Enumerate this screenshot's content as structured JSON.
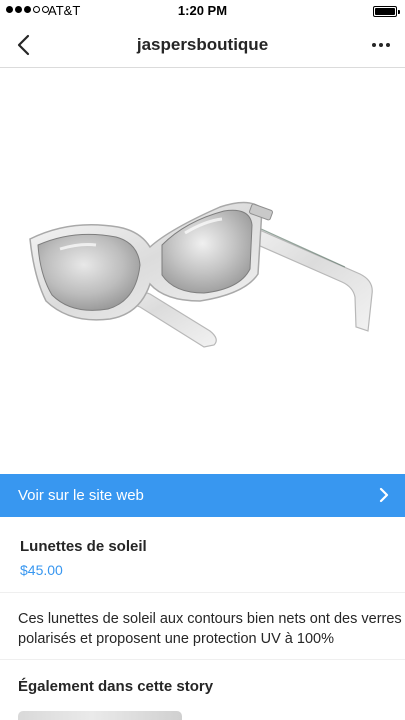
{
  "status_bar": {
    "carrier": "AT&T",
    "time": "1:20 PM",
    "signal_bars": 3,
    "signal_total": 5
  },
  "nav": {
    "title": "jaspersboutique",
    "back_icon": "chevron-left-icon",
    "more_icon": "more-horizontal-icon"
  },
  "web_link": {
    "label": "Voir sur le site web",
    "color": "#3897f0"
  },
  "product": {
    "name": "Lunettes de soleil",
    "price": "$45.00",
    "price_color": "#3897f0",
    "description": "Ces lunettes de soleil aux contours bien nets ont des verres polarisés et proposent une protection UV à 100%"
  },
  "story": {
    "heading": "Également dans cette story"
  }
}
